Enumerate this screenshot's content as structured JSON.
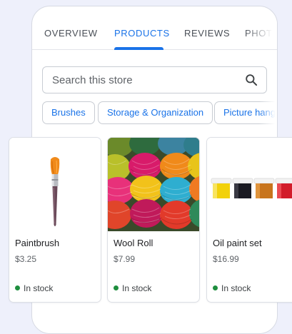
{
  "tabs": [
    {
      "label": "OVERVIEW",
      "active": false
    },
    {
      "label": "PRODUCTS",
      "active": true
    },
    {
      "label": "REVIEWS",
      "active": false
    },
    {
      "label": "PHOTOS",
      "active": false
    }
  ],
  "search": {
    "placeholder": "Search this store",
    "value": ""
  },
  "chips": [
    "Brushes",
    "Storage & Organization",
    "Picture hangers"
  ],
  "products": [
    {
      "name": "Paintbrush",
      "price": "$3.25",
      "stock": "In stock"
    },
    {
      "name": "Wool Roll",
      "price": "$7.99",
      "stock": "In stock"
    },
    {
      "name": "Oil paint set",
      "price": "$16.99",
      "stock": "In stock"
    }
  ],
  "icons": {
    "search": "search-icon"
  },
  "colors": {
    "accent": "#1a73e8",
    "in_stock": "#1e8e3e",
    "background": "#eef0fb"
  }
}
